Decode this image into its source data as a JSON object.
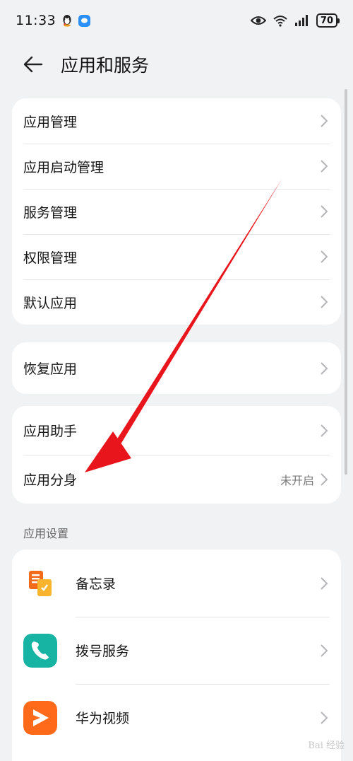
{
  "status_bar": {
    "time": "11:33",
    "battery": "70",
    "icons": [
      "qq-icon",
      "message-icon",
      "eye-icon",
      "wifi-icon",
      "signal-icon",
      "battery-icon"
    ]
  },
  "header": {
    "title": "应用和服务"
  },
  "group1": {
    "items": [
      {
        "label": "应用管理"
      },
      {
        "label": "应用启动管理"
      },
      {
        "label": "服务管理"
      },
      {
        "label": "权限管理"
      },
      {
        "label": "默认应用"
      }
    ]
  },
  "group2": {
    "items": [
      {
        "label": "恢复应用"
      }
    ]
  },
  "group3": {
    "items": [
      {
        "label": "应用助手",
        "value": ""
      },
      {
        "label": "应用分身",
        "value": "未开启"
      }
    ]
  },
  "app_settings": {
    "section_title": "应用设置",
    "apps": [
      {
        "label": "备忘录",
        "icon": "memo-icon",
        "color": "#f5a623"
      },
      {
        "label": "拨号服务",
        "icon": "phone-icon",
        "color": "#17b3a3"
      },
      {
        "label": "华为视频",
        "icon": "video-icon",
        "color": "#ff6a1a"
      }
    ]
  },
  "annotation": {
    "arrow_color": "#e8161c"
  },
  "watermark": "Bai 经验"
}
